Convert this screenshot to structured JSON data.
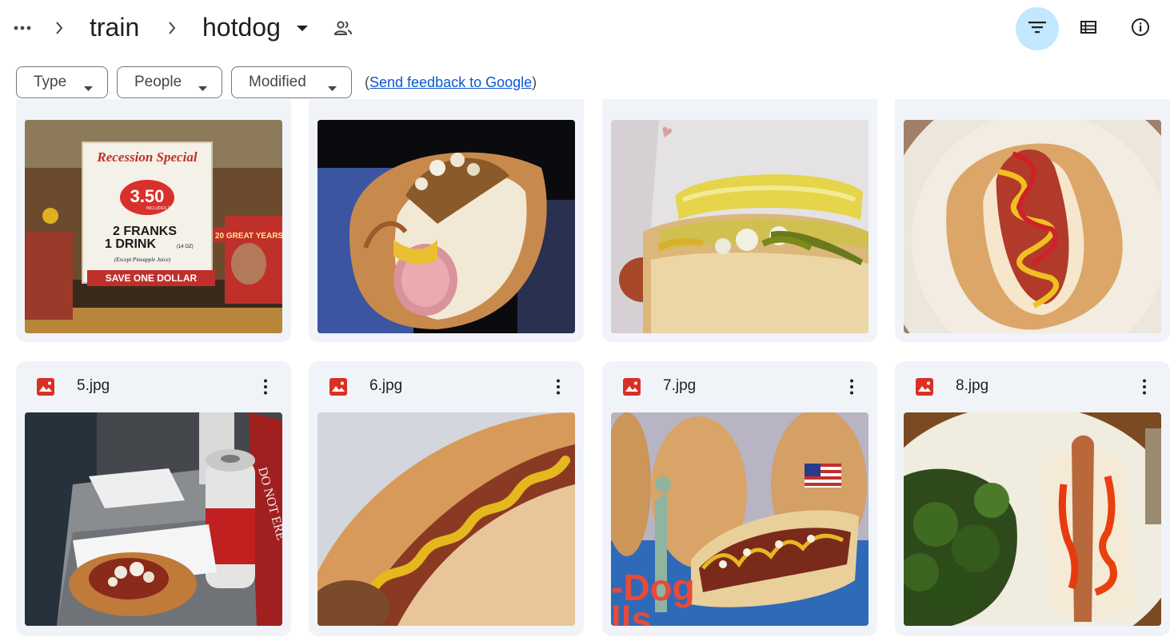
{
  "header": {
    "breadcrumbs": [
      "train",
      "hotdog"
    ],
    "icons": {
      "more": "more-horiz-icon",
      "separator": "chevron-right-icon",
      "folder_menu": "caret-down-icon",
      "shared": "people-icon",
      "filter": "filter-icon",
      "list_view": "list-view-icon",
      "details": "info-icon"
    }
  },
  "filters": {
    "chips": [
      {
        "label": "Type"
      },
      {
        "label": "People"
      },
      {
        "label": "Modified"
      }
    ],
    "feedback_prefix": "(",
    "feedback_link": "Send feedback to Google",
    "feedback_suffix": ")"
  },
  "files": [
    {
      "name": "5.jpg",
      "icon": "image-file-icon"
    },
    {
      "name": "6.jpg",
      "icon": "image-file-icon"
    },
    {
      "name": "7.jpg",
      "icon": "image-file-icon"
    },
    {
      "name": "8.jpg",
      "icon": "image-file-icon"
    }
  ],
  "thumb_text": {
    "sign_title": "Recession Special",
    "price": "3.50",
    "price_note": "INCLUDES TAX",
    "offer_line1": "2 FRANKS",
    "offer_line2": "1 DRINK",
    "offer_size": "(14 OZ)",
    "except_note": "(Except Pineapple Juice)",
    "save_banner": "SAVE ONE DOLLAR",
    "years_banner": "20 GREAT YEARS",
    "bag_text": "-Dog",
    "bag_text2": "lls",
    "sign_corner": "DO NOT ERE"
  },
  "colors": {
    "accent_active": "#c2e7ff",
    "card_bg": "#f0f4f9",
    "link": "#0b57d0",
    "image_icon": "#d93025"
  }
}
